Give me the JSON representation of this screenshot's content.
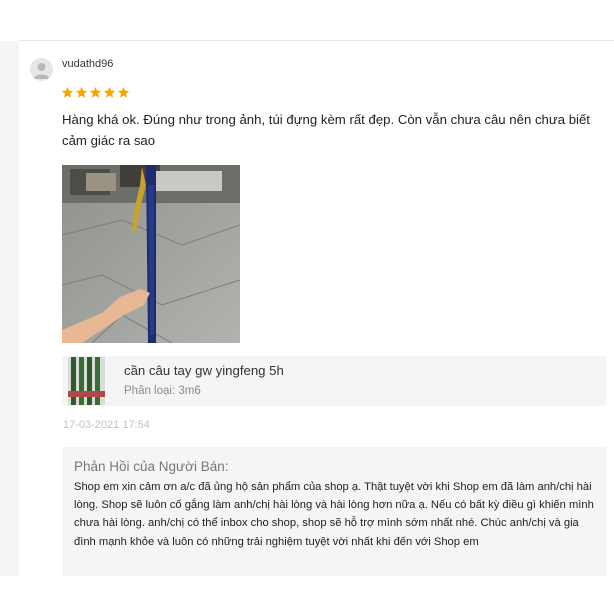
{
  "review": {
    "username": "vudathd96",
    "rating": 5,
    "rating_max": 5,
    "star_color": "#f6a700",
    "text": "Hàng khá ok. Đúng như trong ảnh, túi đựng kèm rất đẹp. Còn vẫn chưa câu nên chưa biết cảm giác ra sao",
    "timestamp": "17-03-2021 17:54"
  },
  "product": {
    "name": "cần câu tay gw yingfeng 5h",
    "variant": "Phân loại: 3m6"
  },
  "seller_reply": {
    "title": "Phản Hồi của Người Bán:",
    "text": "Shop em xin cảm ơn a/c đã ủng hộ sản phẩm của shop ạ. Thật tuyệt vời khi Shop em đã làm anh/chị hài lòng. Shop sẽ luôn cố gắng làm anh/chị hài lòng và hài lòng hơn nữa ạ. Nếu có bất kỳ điều gì khiến mình chưa hài lòng. anh/chị có thể inbox cho shop, shop sẽ hỗ trợ mình sớm nhất nhé. Chúc anh/chị và gia đình mạnh khỏe và luôn có những trải nghiệm tuyệt vời nhất khi đến với Shop em"
  }
}
